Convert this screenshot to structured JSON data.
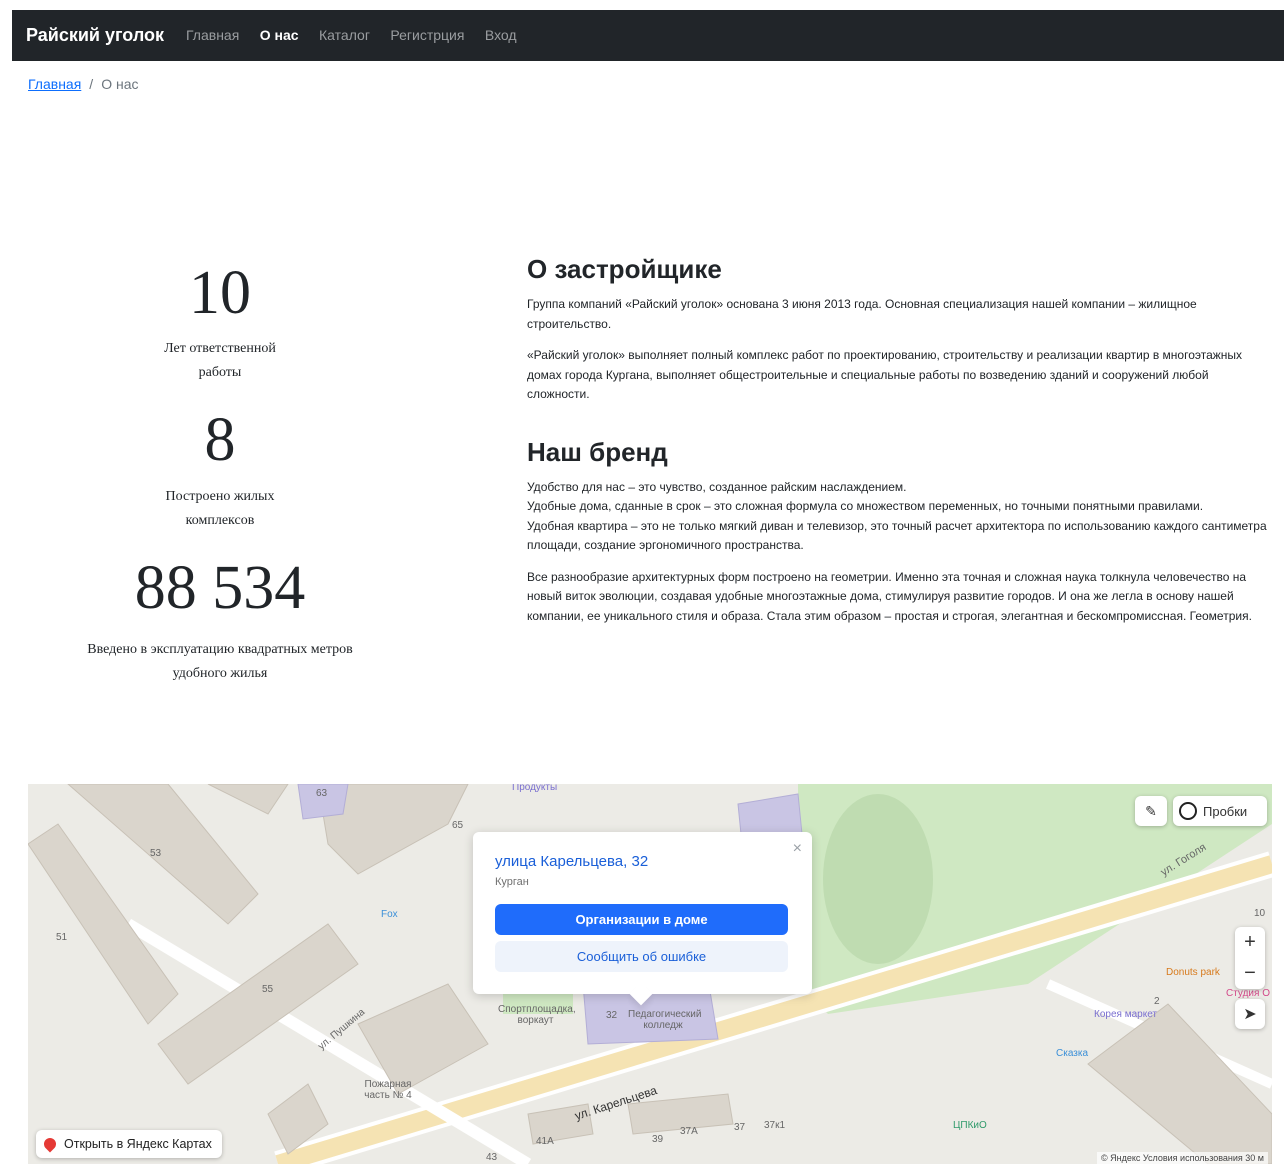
{
  "navbar": {
    "brand": "Райский уголок",
    "links": [
      {
        "label": "Главная",
        "active": false
      },
      {
        "label": "О нас",
        "active": true
      },
      {
        "label": "Каталог",
        "active": false
      },
      {
        "label": "Регистрция",
        "active": false
      },
      {
        "label": "Вход",
        "active": false
      }
    ]
  },
  "breadcrumb": {
    "home": "Главная",
    "separator": "/",
    "current": "О нас"
  },
  "stats": [
    {
      "value": "10",
      "label": "Лет ответственной работы"
    },
    {
      "value": "8",
      "label": "Построено жилых комплексов"
    },
    {
      "value": "88 534",
      "label": "Введено в эксплуатацию квадратных метров удобного жилья"
    }
  ],
  "about": {
    "title": "О застройщике",
    "p1": "Группа компаний «Райский уголок» основана 3 июня 2013 года. Основная специализация нашей компании – жилищное строительство.",
    "p2": "«Райский уголок» выполняет полный комплекс работ по проектированию, строительству и реализации квартир в многоэтажных домах города Кургана, выполняет общестроительные и специальные работы по возведению зданий и сооружений любой сложности."
  },
  "brand": {
    "title": "Наш бренд",
    "lines": [
      "Удобство для нас – это чувство, созданное райским наслаждением.",
      "Удобные дома, сданные в срок – это сложная формула со множеством переменных, но точными понятными правилами.",
      "Удобная квартира – это не только мягкий диван и телевизор, это точный расчет архитектора по использованию каждого сантиметра площади, создание эргономичного пространства."
    ],
    "p2": "Все разнообразие архитектурных форм построено на геометрии. Именно эта точная и сложная наука толкнула человечество на новый виток эволюции, создавая удобные многоэтажные дома, стимулируя развитие городов. И она же легла в основу нашей компании, ее уникального стиля и образа. Стала этим образом – простая и строгая, элегантная и бескомпромиссная. Геометрия."
  },
  "map": {
    "balloon": {
      "address": "улица Карельцева, 32",
      "city": "Курган",
      "primary_button": "Организации в доме",
      "secondary_button": "Сообщить об ошибке",
      "close": "×"
    },
    "traffic_label": "Пробки",
    "zoom_in": "+",
    "zoom_out": "−",
    "open_label": "Открыть в Яндекс Картах",
    "attribution": "© Яндекс  Условия использования   30 м",
    "labels": {
      "products": "Продукты",
      "fox": "Fox",
      "pushkina": "ул. Пушкина",
      "gogolya": "ул. Гоголя",
      "karelceva": "ул. Карельцева",
      "fire": "Пожарная часть № 4",
      "sport": "Спортплощадка, воркаут",
      "college": "Педагогический колледж",
      "donuts": "Donuts park",
      "korean": "Корея маркет",
      "skazka": "Сказка",
      "cpkio": "ЦПКиО",
      "studio": "Студия О"
    },
    "house_numbers": [
      "63",
      "65",
      "53",
      "51",
      "55",
      "32",
      "41А",
      "39",
      "37А",
      "37",
      "37к1",
      "43",
      "2",
      "10"
    ]
  }
}
